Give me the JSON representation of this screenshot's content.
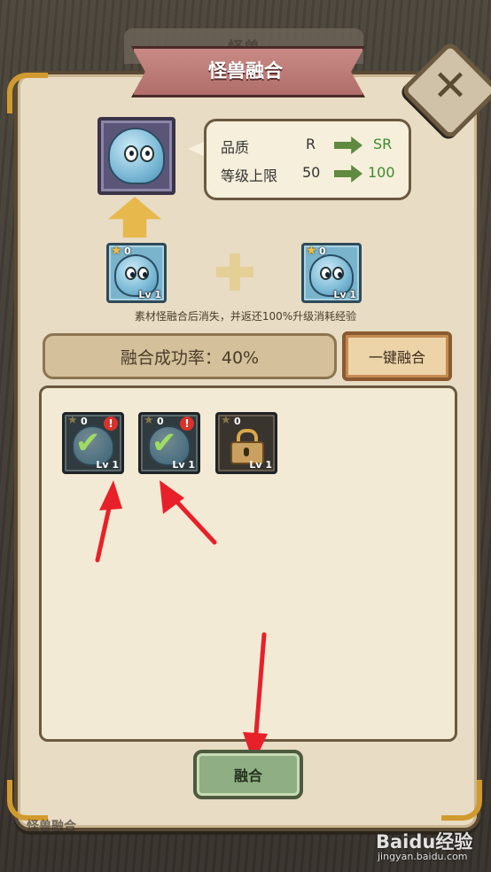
{
  "background_title": "怪兽",
  "title": "怪兽融合",
  "close_label": "✕",
  "info": {
    "quality_label": "品质",
    "quality_from": "R",
    "quality_to": "SR",
    "level_label": "等级上限",
    "level_from": "50",
    "level_to": "100"
  },
  "materials": [
    {
      "stars": "0",
      "level": "Lv 1"
    },
    {
      "stars": "0",
      "level": "Lv 1"
    }
  ],
  "note": "素材怪融合后消失，并返还100%升级消耗经验",
  "success_rate": "融合成功率：40%",
  "one_key_label": "一键融合",
  "list_items": [
    {
      "stars": "0",
      "level": "Lv 1",
      "alert": "!",
      "state": "selected"
    },
    {
      "stars": "0",
      "level": "Lv 1",
      "alert": "!",
      "state": "selected"
    },
    {
      "stars": "0",
      "level": "Lv 1",
      "state": "locked"
    }
  ],
  "fuse_label": "融合",
  "bottom_label": "怪兽融合",
  "watermark": {
    "brand": "Baidu经验",
    "url": "jingyan.baidu.com"
  },
  "colors": {
    "panel": "#e8dcc4",
    "ribbon": "#c98a86",
    "accent_green": "#3f8a2e",
    "arrow_red": "#e8202a",
    "corner_gold": "#d19a2e"
  },
  "icons": [
    "close-icon",
    "up-arrow-icon",
    "plus-icon",
    "star-icon",
    "check-icon",
    "alert-icon",
    "lock-icon",
    "red-arrow-icon"
  ]
}
